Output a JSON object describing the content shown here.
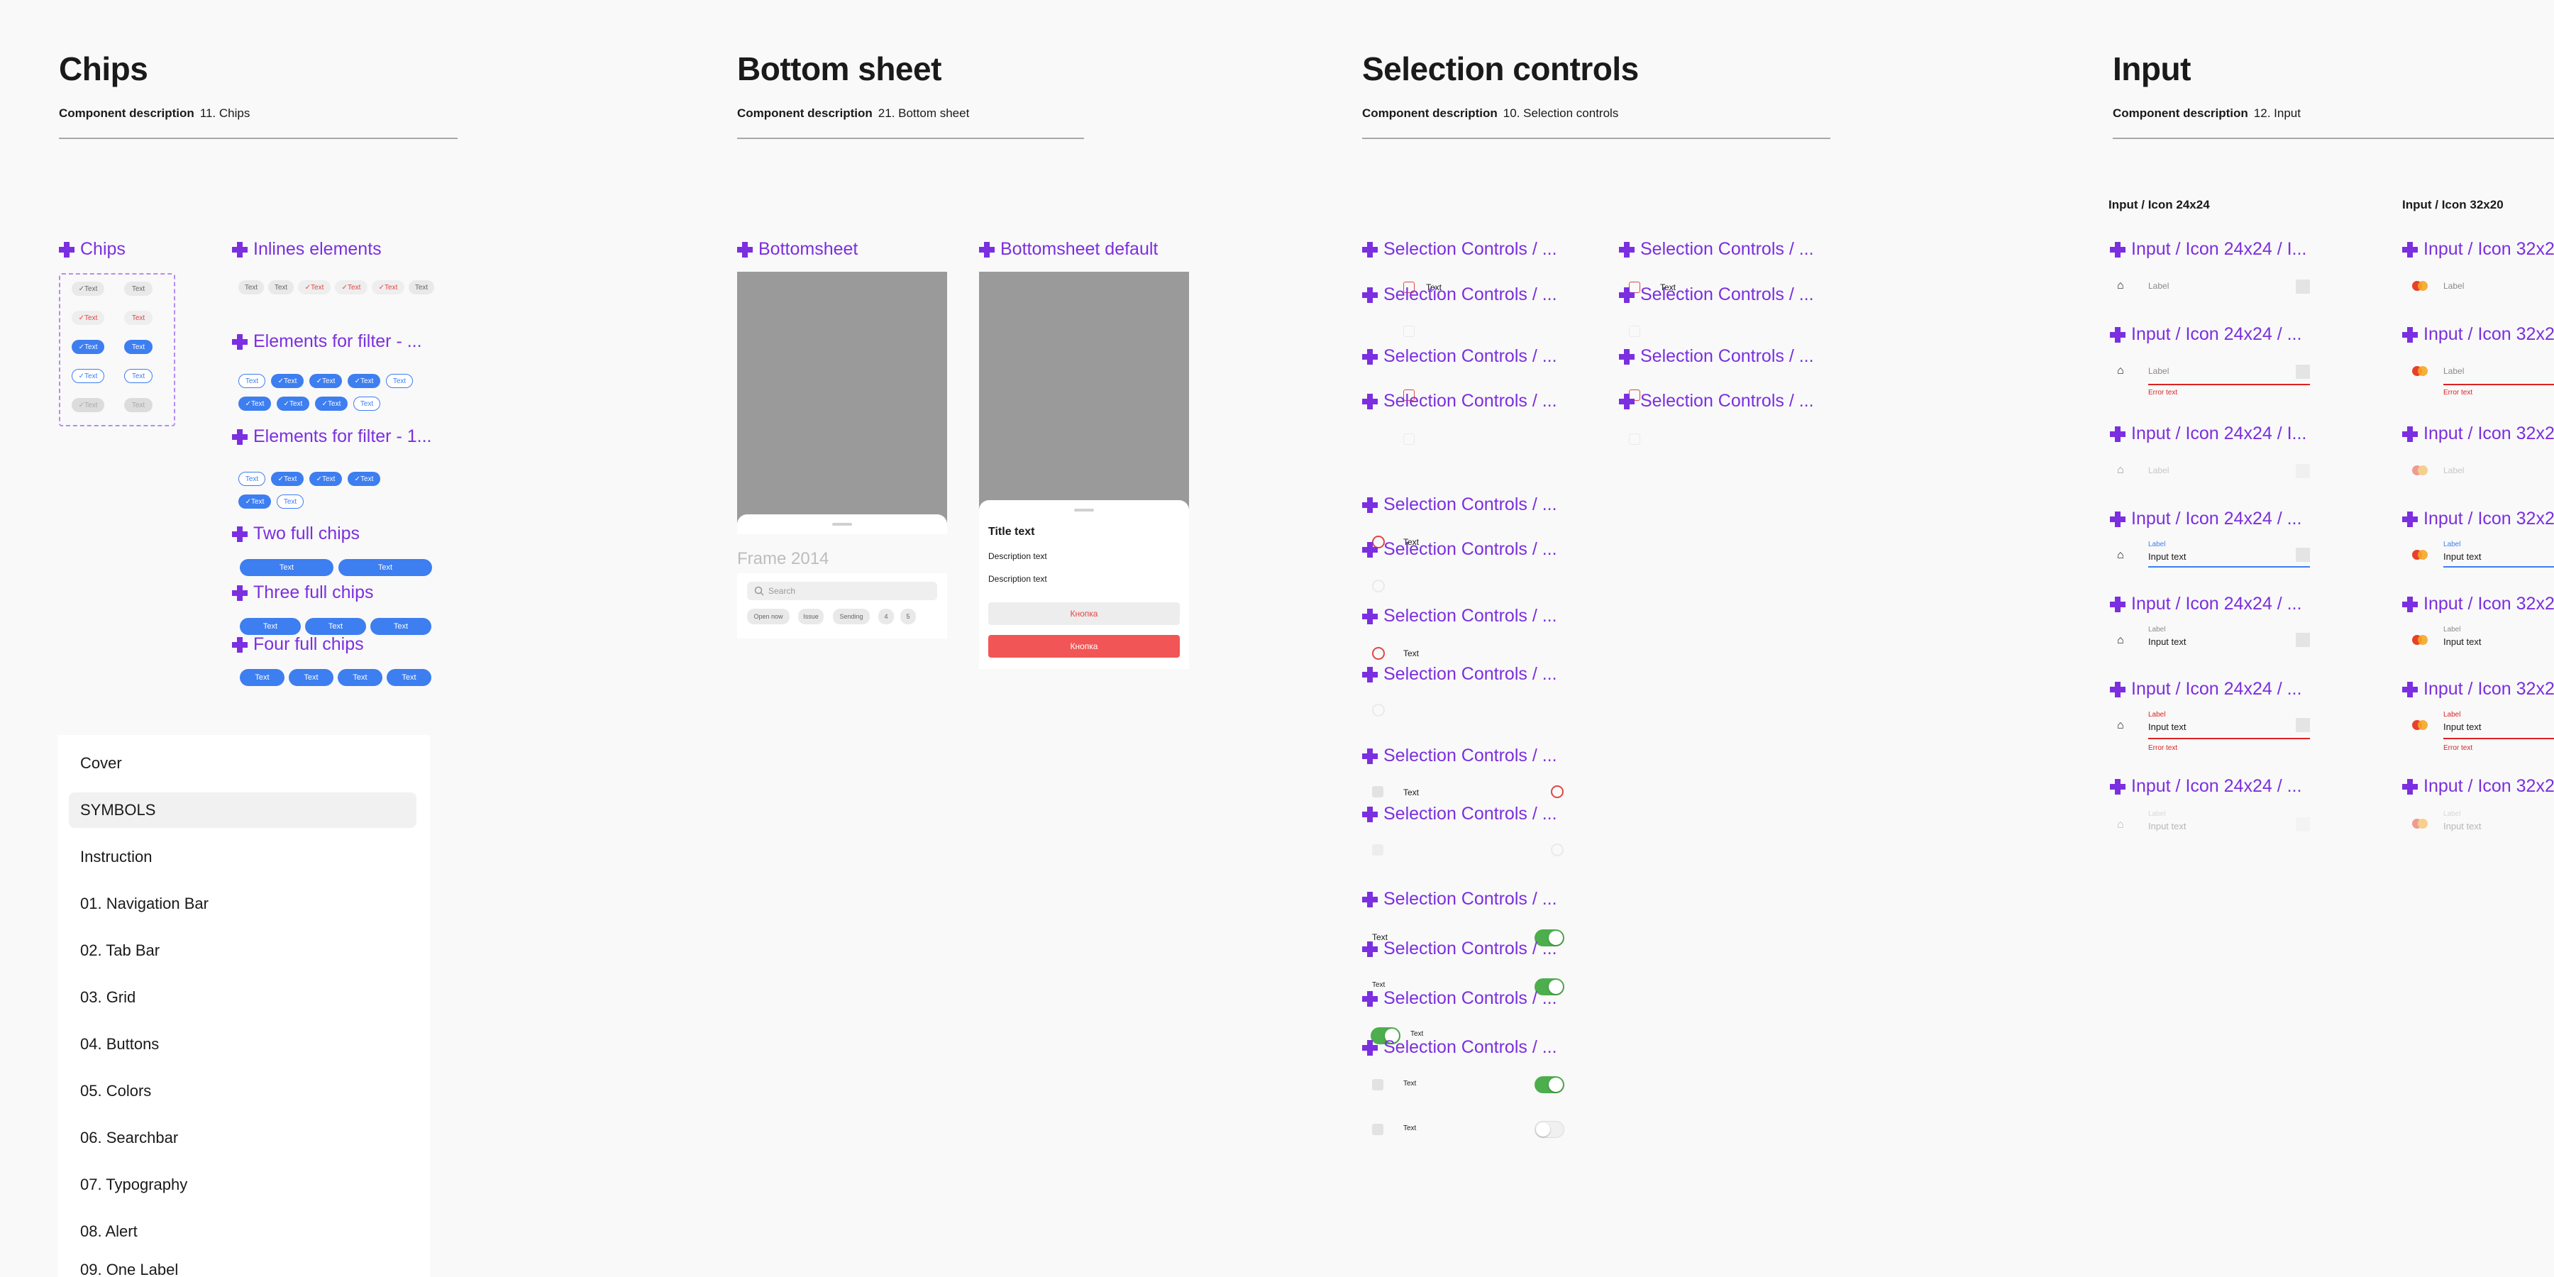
{
  "sections": {
    "chips": {
      "title": "Chips",
      "desc_label": "Component description",
      "desc_value": "11. Chips"
    },
    "bottom_sheet": {
      "title": "Bottom sheet",
      "desc_label": "Component description",
      "desc_value": "21. Bottom sheet"
    },
    "selection": {
      "title": "Selection controls",
      "desc_label": "Component description",
      "desc_value": "10. Selection controls"
    },
    "input": {
      "title": "Input",
      "desc_label": "Component description",
      "desc_value": "12. Input"
    }
  },
  "chips_components": {
    "chips": "Chips",
    "inlines": "Inlines elements",
    "filter1": "Elements for filter - ...",
    "filter2": "Elements for filter - 1...",
    "two_full": "Two full chips",
    "three_full": "Three full chips",
    "four_full": "Four full chips",
    "chip_text": "Text"
  },
  "pages": {
    "items": [
      "Cover",
      "SYMBOLS",
      "Instruction",
      "01. Navigation Bar",
      "02. Tab Bar",
      "03. Grid",
      "04. Buttons",
      "05. Colors",
      "06. Searchbar",
      "07. Typography",
      "08. Alert",
      "09. One Label"
    ],
    "active_index": 1
  },
  "bottomsheet": {
    "comp1": "Bottomsheet",
    "comp2": "Bottomsheet default",
    "frame_label": "Frame 2014",
    "search_placeholder": "Search",
    "filter_chips": [
      "Open now",
      "Issue",
      "Sending",
      "4",
      "5"
    ],
    "title": "Title text",
    "desc1": "Description text",
    "desc2": "Description text",
    "btn1": "Кнопка",
    "btn2": "Кнопка"
  },
  "selection_controls": {
    "comp_a": "Selection Controls / ...",
    "comp_b": "Selection Controls  / ...",
    "text": "Text",
    "colors": {
      "green": "#4cae4c",
      "red": "#e24545"
    }
  },
  "input": {
    "sub1": "Input / Icon 24x24",
    "sub2": "Input / Icon 32x20",
    "col1_names": [
      "Input / Icon 24x24 / I...",
      "Input / Icon 24x24  / ...",
      "Input / Icon 24x24 / I...",
      "Input / Icon 24x24 / ...",
      "Input / Icon 24x24 / ...",
      "Input / Icon 24x24 / ...",
      "Input / Icon 24x24 / ..."
    ],
    "col2_names": [
      "Input / Icon 32x2",
      "Input / Icon 32x2",
      "Input / Icon 32x2",
      "Input / Icon 32x2",
      "Input / Icon 32x2",
      "Input / Icon 32x2",
      "Input / Icon 32x2"
    ],
    "label": "Label",
    "input_text": "Input text",
    "error_text": "Error text"
  }
}
